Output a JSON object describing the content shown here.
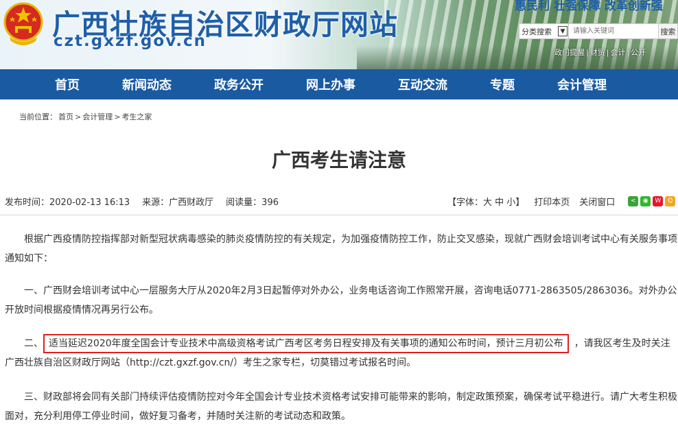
{
  "header": {
    "site_title": "广西壮族自治区财政厅网站",
    "site_url": "czt.gxzf.gov.cn",
    "slogan": "惠民利 壮强保障  改革创新强",
    "search": {
      "category": "分类搜索",
      "placeholder": "请输入关键词",
      "button": "搜索"
    },
    "quick_links": [
      "政门提醒",
      "财贸",
      "会计",
      "公开"
    ]
  },
  "nav": {
    "items": [
      "首页",
      "新闻动态",
      "政务公开",
      "网上办事",
      "互动交流",
      "专题",
      "会计管理"
    ]
  },
  "breadcrumb": {
    "prefix": "当前位置：",
    "items": [
      "首页",
      "会计管理",
      "考生之家"
    ],
    "separator": ">"
  },
  "article": {
    "title": "广西考生请注意",
    "publish_time": "发布时间：2020-02-13 16:13",
    "source": "来源：广西财政厅",
    "reads": "阅读量：396",
    "font_label": "【字体：大 中 小】",
    "print_label": "打印本页",
    "close_label": "关闭窗口",
    "share_icons": [
      "share-icon",
      "wechat-icon",
      "weibo-icon",
      "qq-icon"
    ],
    "paragraphs": {
      "p1": "根据广西疫情防控指挥部对新型冠状病毒感染的肺炎疫情防控的有关规定，为加强疫情防控工作，防止交叉感染，现就广西财会培训考试中心有关服务事项通知如下：",
      "p2": "一、广西财会培训考试中心一层服务大厅从2020年2月3日起暂停对外办公，业务电话咨询工作照常开展，咨询电话0771-2863505/2863036。对外办公开放时间根据疫情情况再另行公布。",
      "p3_prefix": "二、",
      "p3_highlight": "适当延迟2020年度全国会计专业技术中高级资格考试广西考区考务日程安排及有关事项的通知公布时间，预计三月初公布",
      "p3_rest": "，请我区考生及时关注广西壮族自治区财政厅网站（http://czt.gxzf.gov.cn/）考生之家专栏，切莫错过考试报名时间。",
      "p4": "三、财政部将会同有关部门持续评估疫情防控对今年全国会计专业技术资格考试安排可能带来的影响，制定政策预案，确保考试平稳进行。请广大考生积极面对，充分利用停工停业时间，做好复习备考，并随时关注新的考试动态和政策。"
    }
  },
  "colors": {
    "nav_bg": "#1a5aa0",
    "title_blue": "#1f5fa8",
    "highlight_border": "#e02020"
  }
}
